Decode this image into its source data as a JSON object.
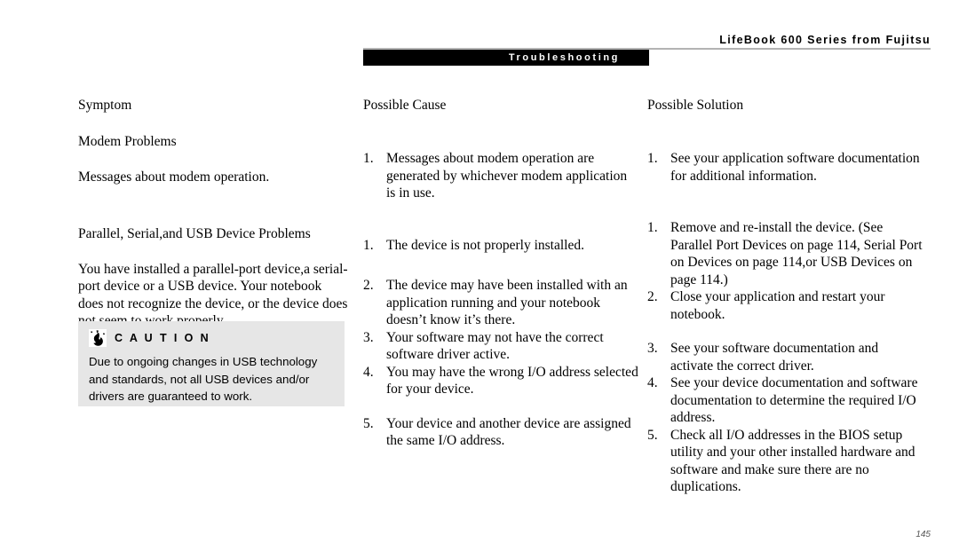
{
  "header": {
    "title": "LifeBook 600 Series from Fujitsu",
    "section_banner": "Troubleshooting"
  },
  "columns": {
    "symptom": {
      "heading": "Symptom",
      "sections": [
        {
          "subheading": "Modem Problems",
          "paragraph": "Messages about modem operation."
        },
        {
          "subheading": "Parallel, Serial,and USB Device Problems",
          "paragraph": "You have installed a parallel-port device,a  serial-port device or a USB device. Your notebook does not recognize the device, or the device does not seem to work properly."
        }
      ]
    },
    "cause": {
      "heading": "Possible Cause",
      "group_modem": [
        {
          "num": "1.",
          "text": "Messages about modem operation are generated by whichever modem application is in use."
        }
      ],
      "group_device": [
        {
          "num": "1.",
          "text": "The device is not properly installed."
        },
        {
          "num": "2.",
          "text": "The device may have been installed with an application running and your notebook doesn’t know it’s there."
        },
        {
          "num": "3.",
          "text": "Your software may not have the correct software driver active."
        },
        {
          "num": "4.",
          "text": "You may have the wrong I/O address selected for your device."
        },
        {
          "num": "5.",
          "text": "Your device and another device are assigned the same I/O address."
        }
      ]
    },
    "solution": {
      "heading": "Possible Solution",
      "group_modem": [
        {
          "num": "1.",
          "text": "See your application software documentation for additional information."
        }
      ],
      "group_device": [
        {
          "num": "1.",
          "text": "Remove and re-install the device. (See  Parallel Port Devices on page 114, Serial Port on Devices on page 114,or USB Devices on page 114.)"
        },
        {
          "num": "2.",
          "text": "Close your application and restart your notebook."
        },
        {
          "num": "3.",
          "text": "See your software documentation and activate the correct driver."
        },
        {
          "num": "4.",
          "text": "See your device documentation and software documentation to determine the required I/O address."
        },
        {
          "num": "5.",
          "text": "Check all I/O addresses in the BIOS setup utility and your other installed hardware and software and make sure there are no duplications."
        }
      ]
    }
  },
  "caution": {
    "icon": "caution-flame-icon",
    "label": "C A U T I O N",
    "text": "Due to ongoing changes in USB technology and standards, not all USB devices and/or drivers are guaranteed to work.",
    "background_color": "#e6e6e6"
  },
  "footer": {
    "page_number": "145"
  }
}
